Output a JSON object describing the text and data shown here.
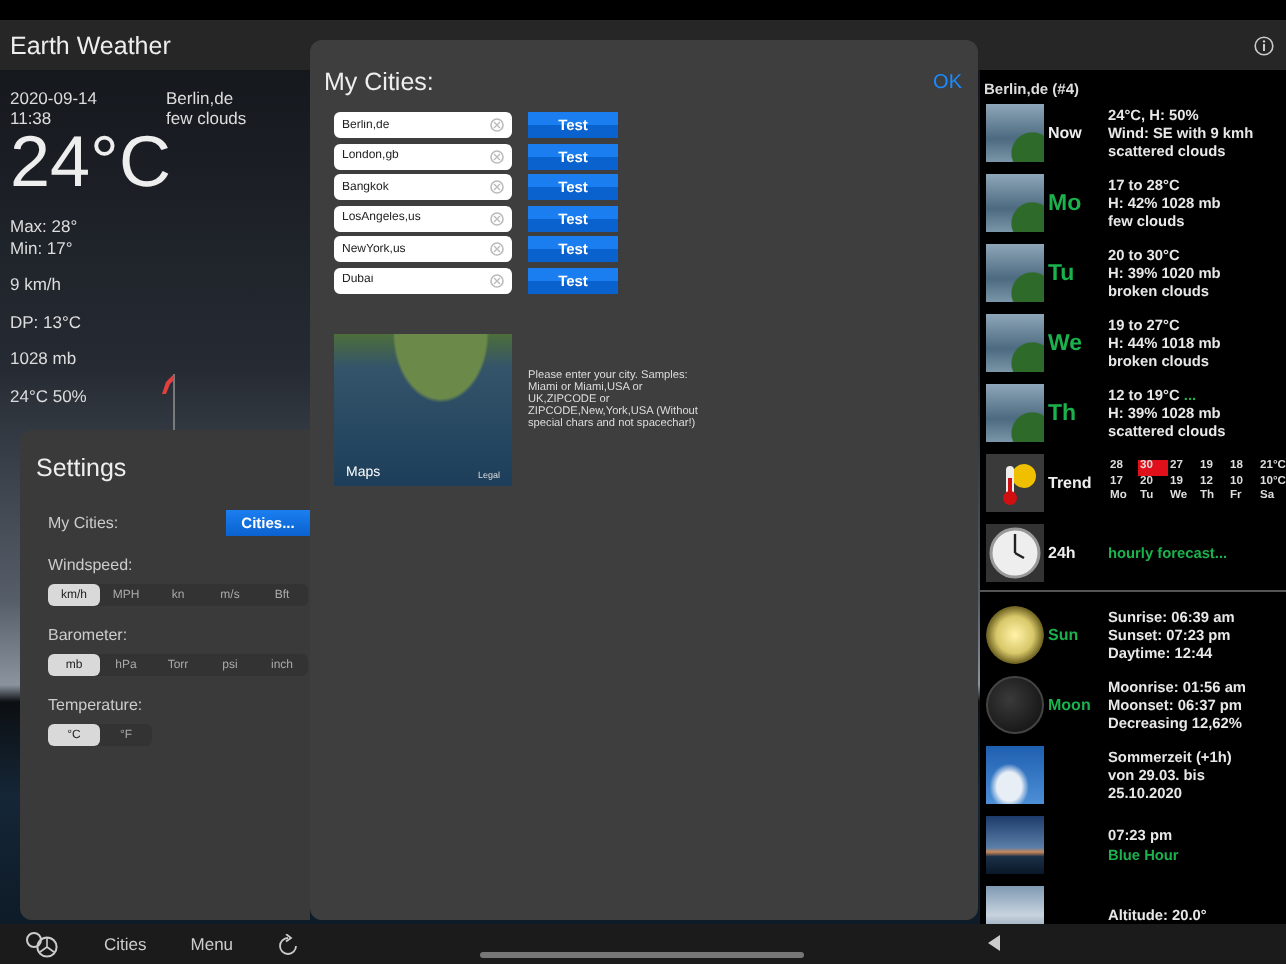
{
  "header": {
    "title": "Earth Weather"
  },
  "current": {
    "date": "2020-09-14",
    "time": "11:38",
    "city": "Berlin,de",
    "condition": "few clouds",
    "temperature": "24°C",
    "max": "Max: 28°",
    "min": "Min: 17°",
    "wind": "9 km/h",
    "dew_point": "DP: 13°C",
    "pressure": "1028 mb",
    "humidity": "24°C 50%"
  },
  "settings": {
    "title": "Settings",
    "my_cities_label": "My Cities:",
    "cities_button": "Cities...",
    "groups": [
      {
        "label": "Windspeed:",
        "options": [
          {
            "label": "km/h",
            "selected": true
          },
          {
            "label": "MPH",
            "selected": false
          },
          {
            "label": "kn",
            "selected": false
          },
          {
            "label": "m/s",
            "selected": false
          },
          {
            "label": "Bft",
            "selected": false
          }
        ]
      },
      {
        "label": "Barometer:",
        "options": [
          {
            "label": "mb",
            "selected": true
          },
          {
            "label": "hPa",
            "selected": false
          },
          {
            "label": "Torr",
            "selected": false
          },
          {
            "label": "psi",
            "selected": false
          },
          {
            "label": "inch",
            "selected": false
          }
        ]
      },
      {
        "label": "Temperature:",
        "options": [
          {
            "label": "°C",
            "selected": true
          },
          {
            "label": "°F",
            "selected": false
          }
        ]
      }
    ]
  },
  "cities_dialog": {
    "title": "My Cities:",
    "ok": "OK",
    "cities": [
      {
        "value": "Berlin,de",
        "button": "Test"
      },
      {
        "value": "London,gb",
        "button": "Test"
      },
      {
        "value": "Bangkok",
        "button": "Test"
      },
      {
        "value": "LosAngeles,us",
        "button": "Test"
      },
      {
        "value": "NewYork,us",
        "button": "Test"
      },
      {
        "value": "Dubai",
        "button": "Test"
      }
    ],
    "map": {
      "brand": "Maps",
      "legal": "Legal"
    },
    "help": "Please enter your city. Samples: Miami or Miami,USA or UK,ZIPCODE or ZIPCODE,New,York,USA (Without special chars and not spacechar!)"
  },
  "forecast": {
    "title": "Berlin,de (#4)",
    "rows": [
      {
        "kind": "current",
        "label": "Now",
        "lines": [
          {
            "text": "24°C, H: 50%",
            "accent": false
          },
          {
            "text": "Wind: SE with 9 kmh",
            "accent": false
          },
          {
            "text": "scattered clouds",
            "accent": false
          }
        ]
      },
      {
        "kind": "day",
        "label": "Mo",
        "lines": [
          {
            "text": "17 to 28°C",
            "accent": false
          },
          {
            "text": "H: 42% 1028 mb",
            "accent": false
          },
          {
            "text": "few clouds",
            "accent": false
          }
        ]
      },
      {
        "kind": "day",
        "label": "Tu",
        "lines": [
          {
            "text": "20 to 30°C",
            "accent": false
          },
          {
            "text": "H: 39% 1020 mb",
            "accent": false
          },
          {
            "text": "broken clouds",
            "accent": false
          }
        ]
      },
      {
        "kind": "day",
        "label": "We",
        "lines": [
          {
            "text": "19 to 27°C",
            "accent": false
          },
          {
            "text": "H: 44% 1018 mb",
            "accent": false
          },
          {
            "text": "broken clouds",
            "accent": false
          }
        ]
      },
      {
        "kind": "day",
        "label": "Th",
        "lines": [
          {
            "text": "12 to 19°C",
            "accent": false,
            "more": "..."
          },
          {
            "text": "H: 39% 1028 mb",
            "accent": false
          },
          {
            "text": "scattered clouds",
            "accent": false
          }
        ]
      },
      {
        "kind": "trend",
        "label": "Trend",
        "trend": {
          "highs": [
            {
              "text": "28",
              "highlighted": false
            },
            {
              "text": "30",
              "highlighted": true
            },
            {
              "text": "27",
              "highlighted": false
            },
            {
              "text": "19",
              "highlighted": false
            },
            {
              "text": "18",
              "highlighted": false
            },
            {
              "text": "21°C",
              "highlighted": false
            }
          ],
          "lows": [
            "17",
            "20",
            "19",
            "12",
            "10",
            "10°C"
          ],
          "days": [
            "Mo",
            "Tu",
            "We",
            "Th",
            "Fr",
            "Sa"
          ]
        }
      },
      {
        "kind": "hourly",
        "label": "24h",
        "lines": [
          {
            "text": "hourly forecast...",
            "accent": true
          }
        ]
      }
    ]
  },
  "almanac": {
    "rows": [
      {
        "kind": "sun",
        "label": "Sun",
        "lines": [
          {
            "text": "Sunrise: 06:39 am",
            "accent": false
          },
          {
            "text": "Sunset: 07:23 pm",
            "accent": false
          },
          {
            "text": "Daytime: 12:44",
            "accent": false
          }
        ]
      },
      {
        "kind": "moon",
        "label": "Moon",
        "lines": [
          {
            "text": "Moonrise: 01:56 am",
            "accent": false
          },
          {
            "text": "Moonset: 06:37 pm",
            "accent": false
          },
          {
            "text": "Decreasing 12,62%",
            "accent": false
          }
        ]
      },
      {
        "kind": "dst",
        "lines": [
          {
            "text": "Sommerzeit (+1h)",
            "accent": false
          },
          {
            "text": "von 29.03. bis",
            "accent": false
          },
          {
            "text": "25.10.2020",
            "accent": false
          }
        ]
      },
      {
        "kind": "blue_hour",
        "lines": [
          {
            "text": "07:23 pm",
            "accent": false
          },
          {
            "text": "Blue Hour",
            "accent": true
          }
        ]
      },
      {
        "kind": "satellite",
        "lines": [
          {
            "text": "Altitude: 20.0°",
            "accent": false
          }
        ]
      }
    ]
  },
  "toolbar": {
    "items": [
      "Cities",
      "Menu"
    ]
  }
}
